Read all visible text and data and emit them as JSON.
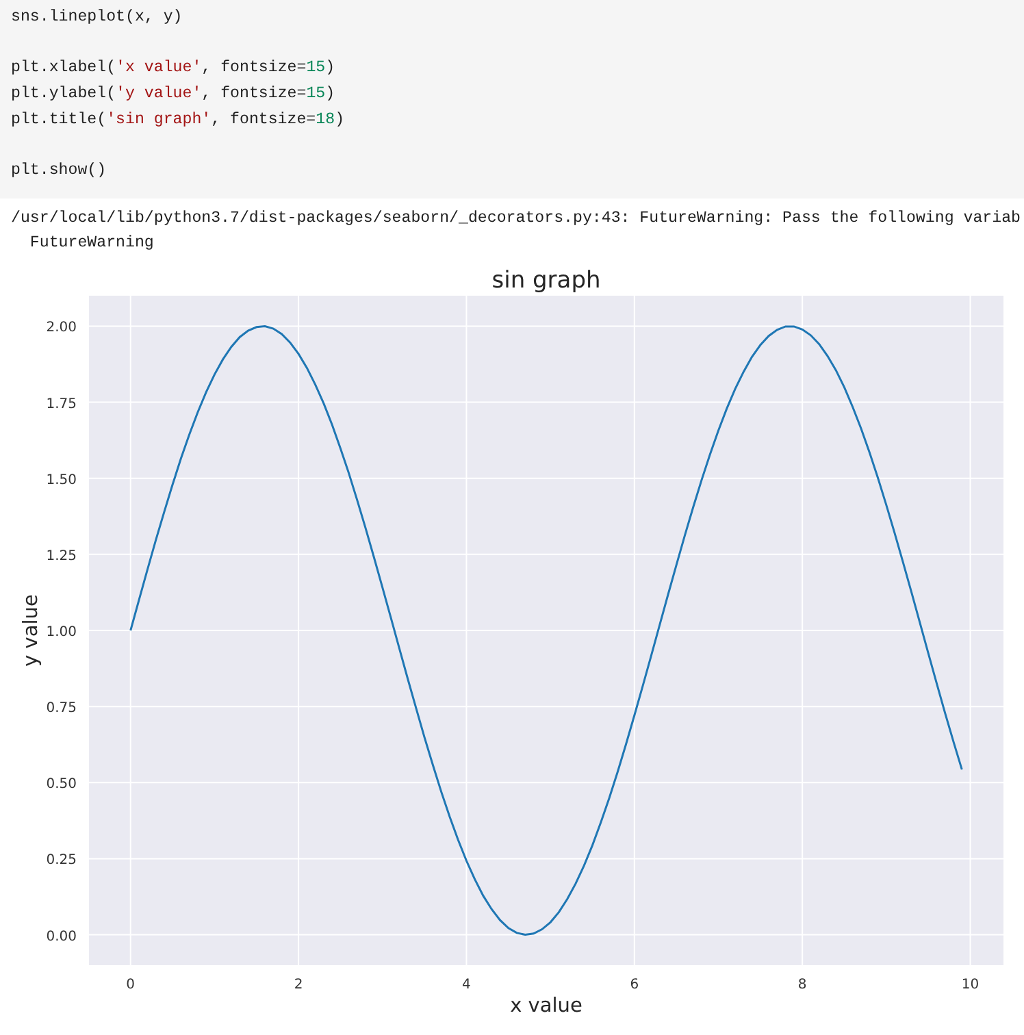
{
  "code_cell": {
    "blocks": [
      [
        [
          {
            "kind": "plain",
            "text": "sns.lineplot(x, y)"
          }
        ]
      ],
      [
        [
          {
            "kind": "plain",
            "text": "plt.xlabel("
          },
          {
            "kind": "string",
            "text": "'x value'"
          },
          {
            "kind": "plain",
            "text": ", fontsize="
          },
          {
            "kind": "number",
            "text": "15"
          },
          {
            "kind": "plain",
            "text": ")"
          }
        ],
        [
          {
            "kind": "plain",
            "text": "plt.ylabel("
          },
          {
            "kind": "string",
            "text": "'y value'"
          },
          {
            "kind": "plain",
            "text": ", fontsize="
          },
          {
            "kind": "number",
            "text": "15"
          },
          {
            "kind": "plain",
            "text": ")"
          }
        ],
        [
          {
            "kind": "plain",
            "text": "plt.title("
          },
          {
            "kind": "string",
            "text": "'sin graph'"
          },
          {
            "kind": "plain",
            "text": ", fontsize="
          },
          {
            "kind": "number",
            "text": "18"
          },
          {
            "kind": "plain",
            "text": ")"
          }
        ]
      ],
      [
        [
          {
            "kind": "plain",
            "text": "plt.show()"
          }
        ]
      ]
    ]
  },
  "output": {
    "lines": [
      "/usr/local/lib/python3.7/dist-packages/seaborn/_decorators.py:43: FutureWarning: Pass the following variab",
      "  FutureWarning"
    ],
    "chart_data": {
      "type": "line",
      "title": "sin graph",
      "xlabel": "x value",
      "ylabel": "y value",
      "x": [
        0,
        0.1,
        0.2,
        0.3,
        0.4,
        0.5,
        0.6,
        0.7,
        0.8,
        0.9,
        1,
        1.1,
        1.2,
        1.3,
        1.4,
        1.5,
        1.6,
        1.7,
        1.8,
        1.9,
        2,
        2.1,
        2.2,
        2.3,
        2.4,
        2.5,
        2.6,
        2.7,
        2.8,
        2.9,
        3,
        3.1,
        3.2,
        3.3,
        3.4,
        3.5,
        3.6,
        3.7,
        3.8,
        3.9,
        4,
        4.1,
        4.2,
        4.3,
        4.4,
        4.5,
        4.6,
        4.7,
        4.8,
        4.9,
        5,
        5.1,
        5.2,
        5.3,
        5.4,
        5.5,
        5.6,
        5.7,
        5.8,
        5.9,
        6,
        6.1,
        6.2,
        6.3,
        6.4,
        6.5,
        6.6,
        6.7,
        6.8,
        6.9,
        7,
        7.1,
        7.2,
        7.3,
        7.4,
        7.5,
        7.6,
        7.7,
        7.8,
        7.9,
        8,
        8.1,
        8.2,
        8.3,
        8.4,
        8.5,
        8.6,
        8.7,
        8.8,
        8.9,
        9,
        9.1,
        9.2,
        9.3,
        9.4,
        9.5,
        9.6,
        9.7,
        9.8,
        9.9
      ],
      "series": [
        {
          "color": "#1f77b4",
          "values": [
            1.0,
            1.1,
            1.199,
            1.296,
            1.389,
            1.479,
            1.565,
            1.644,
            1.717,
            1.783,
            1.841,
            1.891,
            1.932,
            1.964,
            1.985,
            1.997,
            2.0,
            1.992,
            1.974,
            1.946,
            1.909,
            1.863,
            1.808,
            1.746,
            1.676,
            1.598,
            1.516,
            1.427,
            1.335,
            1.239,
            1.141,
            1.042,
            0.942,
            0.842,
            0.745,
            0.649,
            0.558,
            0.47,
            0.388,
            0.312,
            0.243,
            0.182,
            0.128,
            0.084,
            0.048,
            0.022,
            0.006,
            0.0,
            0.004,
            0.018,
            0.041,
            0.074,
            0.117,
            0.168,
            0.227,
            0.294,
            0.369,
            0.449,
            0.535,
            0.626,
            0.721,
            0.818,
            0.917,
            1.017,
            1.117,
            1.215,
            1.312,
            1.405,
            1.494,
            1.578,
            1.657,
            1.729,
            1.794,
            1.85,
            1.899,
            1.938,
            1.968,
            1.988,
            1.999,
            1.999,
            1.989,
            1.97,
            1.941,
            1.902,
            1.855,
            1.799,
            1.734,
            1.663,
            1.585,
            1.501,
            1.412,
            1.319,
            1.223,
            1.125,
            1.025,
            0.925,
            0.826,
            0.728,
            0.634,
            0.543
          ]
        }
      ],
      "grid": true,
      "xlim": [
        -0.495,
        10.395
      ],
      "ylim": [
        -0.1,
        2.1
      ],
      "xticks": [
        0,
        2,
        4,
        6,
        8,
        10
      ],
      "yticks": [
        {
          "value": 0,
          "label": "0.00"
        },
        {
          "value": 0.25,
          "label": "0.25"
        },
        {
          "value": 0.5,
          "label": "0.50"
        },
        {
          "value": 0.75,
          "label": "0.75"
        },
        {
          "value": 1,
          "label": "1.00"
        },
        {
          "value": 1.25,
          "label": "1.25"
        },
        {
          "value": 1.5,
          "label": "1.50"
        },
        {
          "value": 1.75,
          "label": "1.75"
        },
        {
          "value": 2,
          "label": "2.00"
        }
      ]
    }
  }
}
